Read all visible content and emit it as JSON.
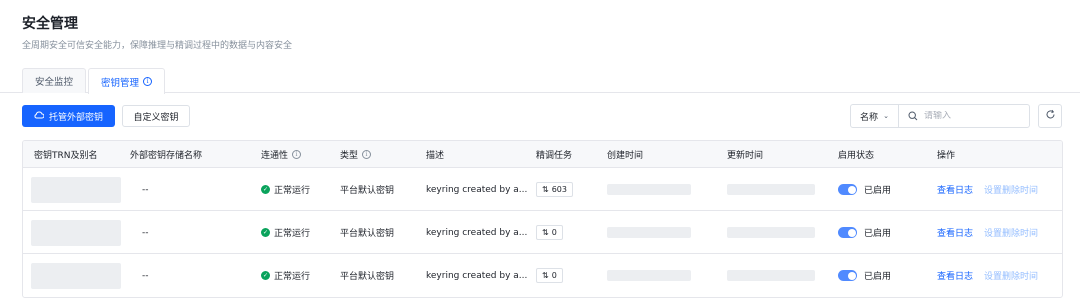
{
  "page": {
    "title": "安全管理",
    "subtitle": "全周期安全可信安全能力，保障推理与精调过程中的数据与内容安全"
  },
  "tabs": [
    {
      "label": "安全监控",
      "active": false
    },
    {
      "label": "密钥管理",
      "active": true,
      "icon": "info-icon"
    }
  ],
  "toolbar": {
    "primary_label": "托管外部密钥",
    "primary_icon": "cloud-icon",
    "secondary_label": "自定义密钥",
    "search_field": "名称",
    "search_placeholder": "请输入",
    "refresh_icon": "refresh-icon"
  },
  "table": {
    "columns": [
      {
        "label": "密钥TRN及别名"
      },
      {
        "label": "外部密钥存储名称"
      },
      {
        "label": "连通性",
        "icon": "info-icon"
      },
      {
        "label": "类型",
        "icon": "info-icon"
      },
      {
        "label": "描述"
      },
      {
        "label": "精调任务"
      },
      {
        "label": "创建时间"
      },
      {
        "label": "更新时间"
      },
      {
        "label": "启用状态"
      },
      {
        "label": "操作"
      }
    ],
    "rows": [
      {
        "store": "--",
        "status": "正常运行",
        "type": "平台默认密钥",
        "description": "keyring created by a...",
        "tasks": "603",
        "enabled": true,
        "enabled_label": "已启用",
        "action_log": "查看日志",
        "action_delete": "设置删除时间"
      },
      {
        "store": "--",
        "status": "正常运行",
        "type": "平台默认密钥",
        "description": "keyring created by a...",
        "tasks": "0",
        "enabled": true,
        "enabled_label": "已启用",
        "action_log": "查看日志",
        "action_delete": "设置删除时间"
      },
      {
        "store": "--",
        "status": "正常运行",
        "type": "平台默认密钥",
        "description": "keyring created by a...",
        "tasks": "0",
        "enabled": true,
        "enabled_label": "已启用",
        "action_log": "查看日志",
        "action_delete": "设置删除时间"
      }
    ]
  },
  "colors": {
    "primary": "#1664ff",
    "success": "#0aa35c",
    "border": "#e5e6eb",
    "header_bg": "#f7f8fa"
  }
}
